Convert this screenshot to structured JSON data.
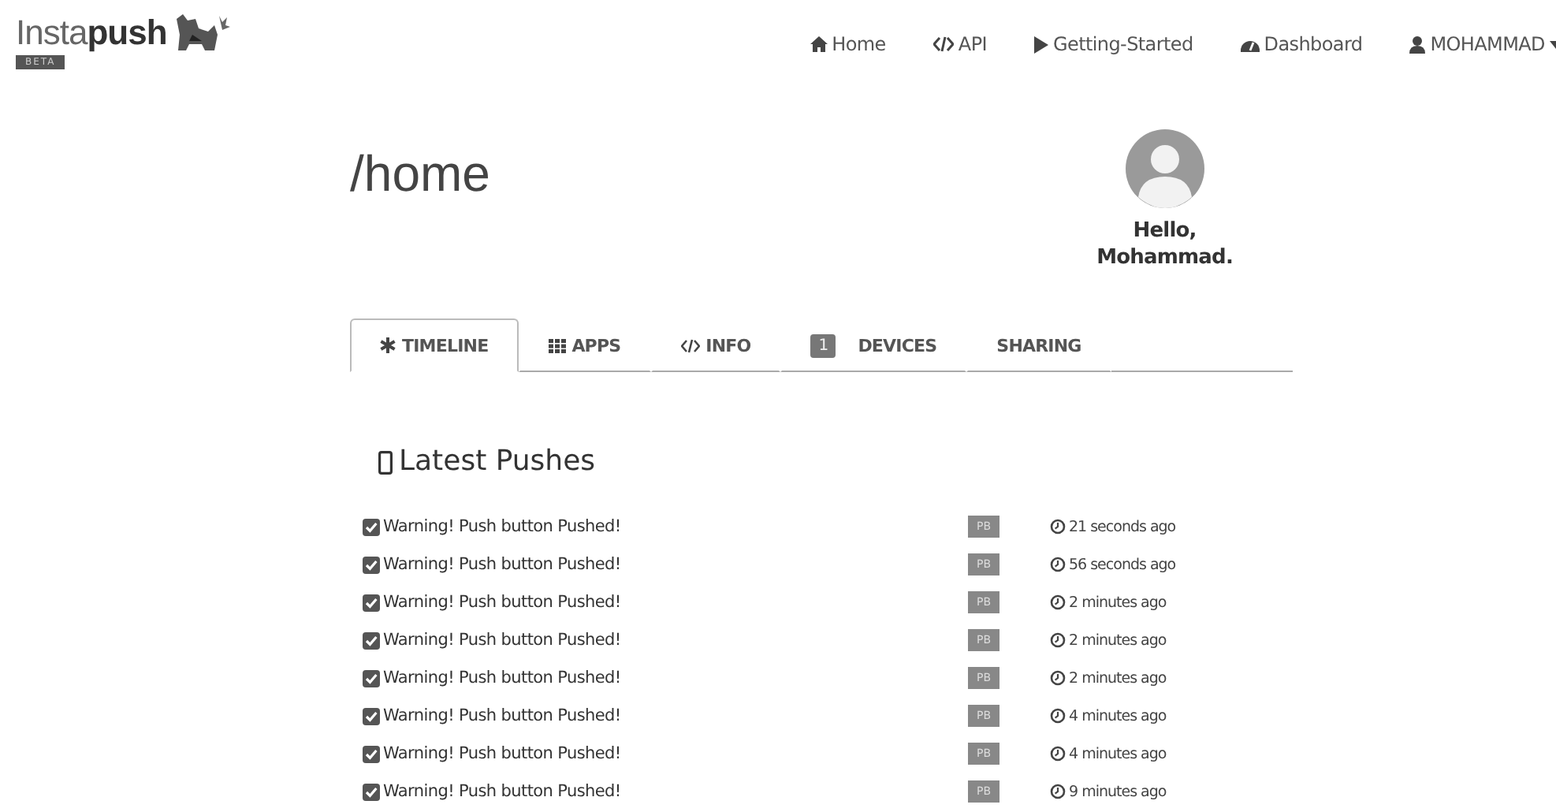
{
  "brand": {
    "name": "Insta**push**",
    "badge": "BETA"
  },
  "nav": [
    {
      "kind": "home",
      "label": "Home"
    },
    {
      "kind": "code",
      "label": "API"
    },
    {
      "kind": "play",
      "label": "Getting-Started"
    },
    {
      "kind": "dashboard",
      "label": "Dashboard"
    },
    {
      "kind": "user",
      "label": "MOHAMMAD"
    }
  ],
  "page_title": "/home",
  "greeting": {
    "line1": "Hello,",
    "line2": "Mohammad."
  },
  "tabs": [
    {
      "kind": "asterisk",
      "label": "TIMELINE",
      "selected": true
    },
    {
      "kind": "grid",
      "label": "APPS",
      "selected": false
    },
    {
      "kind": "code",
      "label": "INFO",
      "selected": false
    },
    {
      "kind": "count",
      "count": "1",
      "label": "DEVICES",
      "selected": false
    },
    {
      "kind": "plain",
      "label": "SHARING",
      "selected": false
    }
  ],
  "section_title": "Latest Pushes",
  "pushes": [
    {
      "message": "Warning! Push button Pushed!",
      "app": "PB",
      "time": "21 seconds ago"
    },
    {
      "message": "Warning! Push button Pushed!",
      "app": "PB",
      "time": "56 seconds ago"
    },
    {
      "message": "Warning! Push button Pushed!",
      "app": "PB",
      "time": "2 minutes ago"
    },
    {
      "message": "Warning! Push button Pushed!",
      "app": "PB",
      "time": "2 minutes ago"
    },
    {
      "message": "Warning! Push button Pushed!",
      "app": "PB",
      "time": "2 minutes ago"
    },
    {
      "message": "Warning! Push button Pushed!",
      "app": "PB",
      "time": "4 minutes ago"
    },
    {
      "message": "Warning! Push button Pushed!",
      "app": "PB",
      "time": "4 minutes ago"
    },
    {
      "message": "Warning! Push button Pushed!",
      "app": "PB",
      "time": "9 minutes ago"
    }
  ]
}
